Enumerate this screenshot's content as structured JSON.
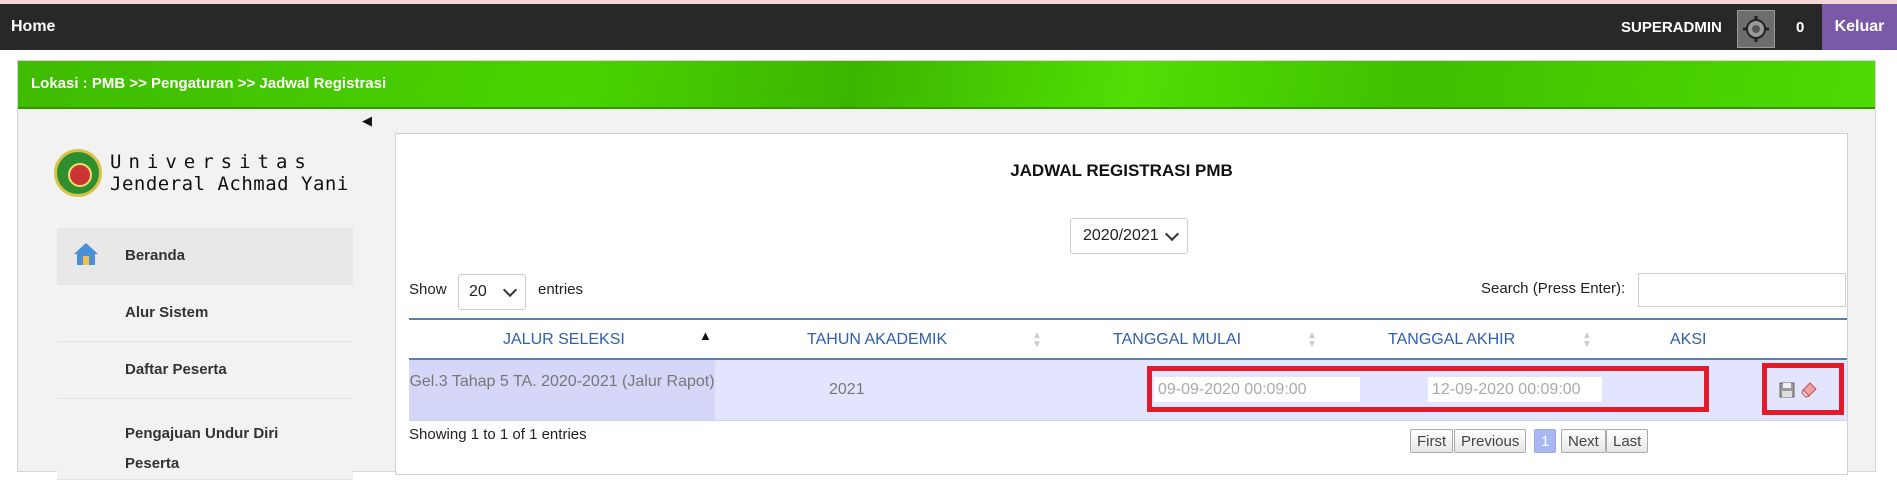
{
  "topbar": {
    "home_label": "Home",
    "user_label": "SUPERADMIN",
    "notif_count": "0",
    "logout_label": "Keluar"
  },
  "breadcrumb": "Lokasi : PMB >> Pengaturan >> Jadwal Registrasi",
  "logo": {
    "line1": "Universitas",
    "line2": "Jenderal Achmad Yani"
  },
  "sidebar": {
    "items": [
      {
        "label": "Beranda",
        "icon": "home-icon"
      },
      {
        "label": "Alur Sistem"
      },
      {
        "label": "Daftar Peserta"
      },
      {
        "label": "Pengajuan Undur Diri Peserta"
      }
    ]
  },
  "page": {
    "title": "JADWAL REGISTRASI PMB",
    "year_selected": "2020/2021"
  },
  "table_controls": {
    "show_label": "Show",
    "length_selected": "20",
    "entries_label": "entries",
    "search_label": "Search (Press Enter):",
    "search_value": ""
  },
  "table": {
    "columns": [
      "JALUR SELEKSI",
      "TAHUN AKADEMIK",
      "TANGGAL MULAI",
      "TANGGAL AKHIR",
      "AKSI"
    ],
    "rows": [
      {
        "jalur": "Gel.3 Tahap 5 TA. 2020-2021 (Jalur Rapot)",
        "tahun": "2021",
        "mulai": "09-09-2020 00:09:00",
        "akhir": "12-09-2020 00:09:00",
        "actions": [
          "save-icon",
          "eraser-icon"
        ]
      }
    ]
  },
  "info": "Showing 1 to 1 of 1 entries",
  "pagination": {
    "first": "First",
    "previous": "Previous",
    "current": "1",
    "next": "Next",
    "last": "Last"
  },
  "colors": {
    "topbar": "#282828",
    "logout": "#7a5aa6",
    "location_bar": "#4ad300",
    "highlight": "#e21b2a",
    "header_text": "#2f5fae",
    "row_bg": "#e3e5ff"
  }
}
